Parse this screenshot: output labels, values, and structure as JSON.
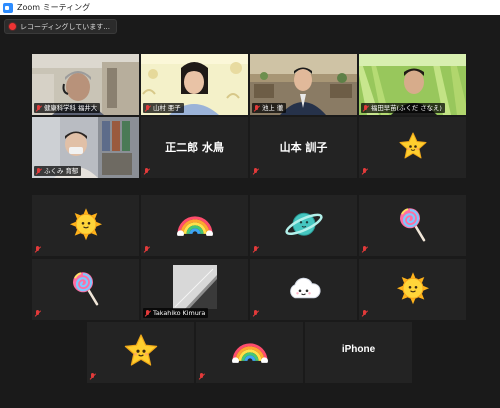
{
  "window": {
    "title": "Zoom ミーティング"
  },
  "recording": {
    "label": "レコーディングしています..."
  },
  "participants": [
    {
      "id": "p1",
      "name": "健康科学科 福井大",
      "type": "video",
      "active": true
    },
    {
      "id": "p2",
      "name": "山村 亜子",
      "type": "video"
    },
    {
      "id": "p3",
      "name": "池上 徹",
      "type": "video"
    },
    {
      "id": "p4",
      "name": "福田早苗(ふくだ さなえ)",
      "type": "video"
    },
    {
      "id": "p5",
      "name": "ふくみ 育郁",
      "type": "video"
    },
    {
      "id": "p6",
      "name": "正二郎 水鳥",
      "type": "name"
    },
    {
      "id": "p7",
      "name": "山本 訓子",
      "type": "name"
    },
    {
      "id": "p8",
      "icon": "star-face-icon",
      "type": "emoji"
    },
    {
      "id": "p9",
      "icon": "sun-face-icon",
      "type": "emoji"
    },
    {
      "id": "p10",
      "icon": "rainbow-icon",
      "type": "emoji"
    },
    {
      "id": "p11",
      "icon": "ringed-planet-icon",
      "type": "emoji"
    },
    {
      "id": "p12",
      "icon": "lollipop-icon",
      "type": "emoji"
    },
    {
      "id": "p13",
      "icon": "lollipop-icon",
      "type": "emoji"
    },
    {
      "id": "p14",
      "name": "Takahiko Kimura",
      "type": "video"
    },
    {
      "id": "p15",
      "icon": "cloud-face-icon",
      "type": "emoji"
    },
    {
      "id": "p16",
      "icon": "sun-face-icon",
      "type": "emoji"
    },
    {
      "id": "p17",
      "icon": "star-face-icon",
      "type": "emoji"
    },
    {
      "id": "p18",
      "icon": "rainbow-icon",
      "type": "emoji"
    },
    {
      "id": "p19",
      "name": "iPhone",
      "type": "name"
    }
  ],
  "colors": {
    "active_speaker": "#d8e84a",
    "muted_mic": "#e23a3a",
    "tile_bg": "#232323",
    "meeting_bg": "#1a1a1a"
  }
}
